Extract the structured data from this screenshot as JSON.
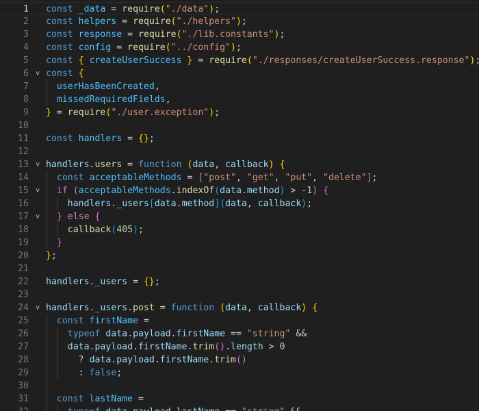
{
  "editor": {
    "language": "javascript",
    "current_line": 1,
    "colors": {
      "background": "#1f1f1f",
      "keyword": "#569cd6",
      "control": "#c586c0",
      "variable": "#9cdcfe",
      "constant": "#4fc1ff",
      "function": "#dcdcaa",
      "string": "#ce9178",
      "number": "#b5cea8",
      "bracket_1": "#ffd700",
      "bracket_2": "#da70d6",
      "bracket_3": "#179fff"
    },
    "lines": [
      {
        "n": "1",
        "fold": "",
        "tokens": [
          [
            "kw",
            "const"
          ],
          [
            "pl",
            " "
          ],
          [
            "cst",
            "_data"
          ],
          [
            "pl",
            " = "
          ],
          [
            "fn",
            "require"
          ],
          [
            "br1",
            "("
          ],
          [
            "str",
            "\"./data\""
          ],
          [
            "br1",
            ")"
          ],
          [
            "pl",
            ";"
          ]
        ]
      },
      {
        "n": "2",
        "fold": "",
        "tokens": [
          [
            "kw",
            "const"
          ],
          [
            "pl",
            " "
          ],
          [
            "cst",
            "helpers"
          ],
          [
            "pl",
            " = "
          ],
          [
            "fn",
            "require"
          ],
          [
            "br1",
            "("
          ],
          [
            "str",
            "\"./helpers\""
          ],
          [
            "br1",
            ")"
          ],
          [
            "pl",
            ";"
          ]
        ]
      },
      {
        "n": "3",
        "fold": "",
        "tokens": [
          [
            "kw",
            "const"
          ],
          [
            "pl",
            " "
          ],
          [
            "cst",
            "response"
          ],
          [
            "pl",
            " = "
          ],
          [
            "fn",
            "require"
          ],
          [
            "br1",
            "("
          ],
          [
            "str",
            "\"./lib.constants\""
          ],
          [
            "br1",
            ")"
          ],
          [
            "pl",
            ";"
          ]
        ]
      },
      {
        "n": "4",
        "fold": "",
        "tokens": [
          [
            "kw",
            "const"
          ],
          [
            "pl",
            " "
          ],
          [
            "cst",
            "config"
          ],
          [
            "pl",
            " = "
          ],
          [
            "fn",
            "require"
          ],
          [
            "br1",
            "("
          ],
          [
            "str",
            "\"../config\""
          ],
          [
            "br1",
            ")"
          ],
          [
            "pl",
            ";"
          ]
        ]
      },
      {
        "n": "5",
        "fold": "",
        "tokens": [
          [
            "kw",
            "const"
          ],
          [
            "pl",
            " "
          ],
          [
            "br1",
            "{"
          ],
          [
            "pl",
            " "
          ],
          [
            "cst",
            "createUserSuccess"
          ],
          [
            "pl",
            " "
          ],
          [
            "br1",
            "}"
          ],
          [
            "pl",
            " = "
          ],
          [
            "fn",
            "require"
          ],
          [
            "br1",
            "("
          ],
          [
            "str",
            "\"./responses/createUserSuccess.response\""
          ],
          [
            "br1",
            ")"
          ],
          [
            "pl",
            ";"
          ]
        ]
      },
      {
        "n": "6",
        "fold": "v",
        "tokens": [
          [
            "kw",
            "const"
          ],
          [
            "pl",
            " "
          ],
          [
            "br1",
            "{"
          ]
        ]
      },
      {
        "n": "7",
        "fold": "",
        "tokens": [
          [
            "pl",
            "  "
          ],
          [
            "cst",
            "userHasBeenCreated"
          ],
          [
            "pl",
            ","
          ]
        ]
      },
      {
        "n": "8",
        "fold": "",
        "tokens": [
          [
            "pl",
            "  "
          ],
          [
            "cst",
            "missedRequiredFields"
          ],
          [
            "pl",
            ","
          ]
        ]
      },
      {
        "n": "9",
        "fold": "",
        "tokens": [
          [
            "br1",
            "}"
          ],
          [
            "pl",
            " = "
          ],
          [
            "fn",
            "require"
          ],
          [
            "br1",
            "("
          ],
          [
            "str",
            "\"./user.exception\""
          ],
          [
            "br1",
            ")"
          ],
          [
            "pl",
            ";"
          ]
        ]
      },
      {
        "n": "10",
        "fold": "",
        "tokens": []
      },
      {
        "n": "11",
        "fold": "",
        "tokens": [
          [
            "kw",
            "const"
          ],
          [
            "pl",
            " "
          ],
          [
            "cst",
            "handlers"
          ],
          [
            "pl",
            " = "
          ],
          [
            "br1",
            "{}"
          ],
          [
            "pl",
            ";"
          ]
        ]
      },
      {
        "n": "12",
        "fold": "",
        "tokens": []
      },
      {
        "n": "13",
        "fold": "v",
        "tokens": [
          [
            "var",
            "handlers"
          ],
          [
            "pl",
            "."
          ],
          [
            "fn",
            "users"
          ],
          [
            "pl",
            " = "
          ],
          [
            "kw",
            "function"
          ],
          [
            "pl",
            " "
          ],
          [
            "br1",
            "("
          ],
          [
            "var",
            "data"
          ],
          [
            "pl",
            ", "
          ],
          [
            "var",
            "callback"
          ],
          [
            "br1",
            ")"
          ],
          [
            "pl",
            " "
          ],
          [
            "br1",
            "{"
          ]
        ]
      },
      {
        "n": "14",
        "fold": "",
        "tokens": [
          [
            "pl",
            "  "
          ],
          [
            "kw",
            "const"
          ],
          [
            "pl",
            " "
          ],
          [
            "cst",
            "acceptableMethods"
          ],
          [
            "pl",
            " = "
          ],
          [
            "br2",
            "["
          ],
          [
            "str",
            "\"post\""
          ],
          [
            "pl",
            ", "
          ],
          [
            "str",
            "\"get\""
          ],
          [
            "pl",
            ", "
          ],
          [
            "str",
            "\"put\""
          ],
          [
            "pl",
            ", "
          ],
          [
            "str",
            "\"delete\""
          ],
          [
            "br2",
            "]"
          ],
          [
            "pl",
            ";"
          ]
        ]
      },
      {
        "n": "15",
        "fold": "v",
        "tokens": [
          [
            "pl",
            "  "
          ],
          [
            "ctl",
            "if"
          ],
          [
            "pl",
            " "
          ],
          [
            "br2",
            "("
          ],
          [
            "cst",
            "acceptableMethods"
          ],
          [
            "pl",
            "."
          ],
          [
            "fn",
            "indexOf"
          ],
          [
            "br3",
            "("
          ],
          [
            "var",
            "data"
          ],
          [
            "pl",
            "."
          ],
          [
            "var",
            "method"
          ],
          [
            "br3",
            ")"
          ],
          [
            "pl",
            " > "
          ],
          [
            "num",
            "-1"
          ],
          [
            "br2",
            ")"
          ],
          [
            "pl",
            " "
          ],
          [
            "br2",
            "{"
          ]
        ]
      },
      {
        "n": "16",
        "fold": "",
        "tokens": [
          [
            "pl",
            "    "
          ],
          [
            "var",
            "handlers"
          ],
          [
            "pl",
            "."
          ],
          [
            "var",
            "_users"
          ],
          [
            "br3",
            "["
          ],
          [
            "var",
            "data"
          ],
          [
            "pl",
            "."
          ],
          [
            "var",
            "method"
          ],
          [
            "br3",
            "]"
          ],
          [
            "br3",
            "("
          ],
          [
            "var",
            "data"
          ],
          [
            "pl",
            ", "
          ],
          [
            "var",
            "callback"
          ],
          [
            "br3",
            ")"
          ],
          [
            "pl",
            ";"
          ]
        ]
      },
      {
        "n": "17",
        "fold": "v",
        "tokens": [
          [
            "pl",
            "  "
          ],
          [
            "br2",
            "}"
          ],
          [
            "pl",
            " "
          ],
          [
            "ctl",
            "else"
          ],
          [
            "pl",
            " "
          ],
          [
            "br2",
            "{"
          ]
        ]
      },
      {
        "n": "18",
        "fold": "",
        "tokens": [
          [
            "pl",
            "    "
          ],
          [
            "fn",
            "callback"
          ],
          [
            "br3",
            "("
          ],
          [
            "num",
            "405"
          ],
          [
            "br3",
            ")"
          ],
          [
            "pl",
            ";"
          ]
        ]
      },
      {
        "n": "19",
        "fold": "",
        "tokens": [
          [
            "pl",
            "  "
          ],
          [
            "br2",
            "}"
          ]
        ]
      },
      {
        "n": "20",
        "fold": "",
        "tokens": [
          [
            "br1",
            "}"
          ],
          [
            "pl",
            ";"
          ]
        ]
      },
      {
        "n": "21",
        "fold": "",
        "tokens": []
      },
      {
        "n": "22",
        "fold": "",
        "tokens": [
          [
            "var",
            "handlers"
          ],
          [
            "pl",
            "."
          ],
          [
            "var",
            "_users"
          ],
          [
            "pl",
            " = "
          ],
          [
            "br1",
            "{}"
          ],
          [
            "pl",
            ";"
          ]
        ]
      },
      {
        "n": "23",
        "fold": "",
        "tokens": []
      },
      {
        "n": "24",
        "fold": "v",
        "tokens": [
          [
            "var",
            "handlers"
          ],
          [
            "pl",
            "."
          ],
          [
            "var",
            "_users"
          ],
          [
            "pl",
            "."
          ],
          [
            "fn",
            "post"
          ],
          [
            "pl",
            " = "
          ],
          [
            "kw",
            "function"
          ],
          [
            "pl",
            " "
          ],
          [
            "br1",
            "("
          ],
          [
            "var",
            "data"
          ],
          [
            "pl",
            ", "
          ],
          [
            "var",
            "callback"
          ],
          [
            "br1",
            ")"
          ],
          [
            "pl",
            " "
          ],
          [
            "br1",
            "{"
          ]
        ]
      },
      {
        "n": "25",
        "fold": "",
        "tokens": [
          [
            "pl",
            "  "
          ],
          [
            "kw",
            "const"
          ],
          [
            "pl",
            " "
          ],
          [
            "cst",
            "firstName"
          ],
          [
            "pl",
            " ="
          ]
        ]
      },
      {
        "n": "26",
        "fold": "",
        "tokens": [
          [
            "pl",
            "    "
          ],
          [
            "kw",
            "typeof"
          ],
          [
            "pl",
            " "
          ],
          [
            "var",
            "data"
          ],
          [
            "pl",
            "."
          ],
          [
            "var",
            "payload"
          ],
          [
            "pl",
            "."
          ],
          [
            "var",
            "firstName"
          ],
          [
            "pl",
            " == "
          ],
          [
            "str",
            "\"string\""
          ],
          [
            "pl",
            " &&"
          ]
        ]
      },
      {
        "n": "27",
        "fold": "",
        "tokens": [
          [
            "pl",
            "    "
          ],
          [
            "var",
            "data"
          ],
          [
            "pl",
            "."
          ],
          [
            "var",
            "payload"
          ],
          [
            "pl",
            "."
          ],
          [
            "var",
            "firstName"
          ],
          [
            "pl",
            "."
          ],
          [
            "fn",
            "trim"
          ],
          [
            "br2",
            "()"
          ],
          [
            "pl",
            "."
          ],
          [
            "var",
            "length"
          ],
          [
            "pl",
            " > "
          ],
          [
            "num",
            "0"
          ]
        ]
      },
      {
        "n": "28",
        "fold": "",
        "tokens": [
          [
            "pl",
            "      ? "
          ],
          [
            "var",
            "data"
          ],
          [
            "pl",
            "."
          ],
          [
            "var",
            "payload"
          ],
          [
            "pl",
            "."
          ],
          [
            "var",
            "firstName"
          ],
          [
            "pl",
            "."
          ],
          [
            "fn",
            "trim"
          ],
          [
            "br2",
            "()"
          ]
        ]
      },
      {
        "n": "29",
        "fold": "",
        "tokens": [
          [
            "pl",
            "      : "
          ],
          [
            "kw",
            "false"
          ],
          [
            "pl",
            ";"
          ]
        ]
      },
      {
        "n": "30",
        "fold": "",
        "tokens": []
      },
      {
        "n": "31",
        "fold": "",
        "tokens": [
          [
            "pl",
            "  "
          ],
          [
            "kw",
            "const"
          ],
          [
            "pl",
            " "
          ],
          [
            "cst",
            "lastName"
          ],
          [
            "pl",
            " ="
          ]
        ]
      },
      {
        "n": "32",
        "fold": "",
        "tokens": [
          [
            "pl",
            "    "
          ],
          [
            "kw",
            "typeof"
          ],
          [
            "pl",
            " "
          ],
          [
            "var",
            "data"
          ],
          [
            "pl",
            "."
          ],
          [
            "var",
            "payload"
          ],
          [
            "pl",
            "."
          ],
          [
            "var",
            "lastName"
          ],
          [
            "pl",
            " == "
          ],
          [
            "str",
            "\"string\""
          ],
          [
            "pl",
            " &&"
          ]
        ]
      }
    ]
  }
}
